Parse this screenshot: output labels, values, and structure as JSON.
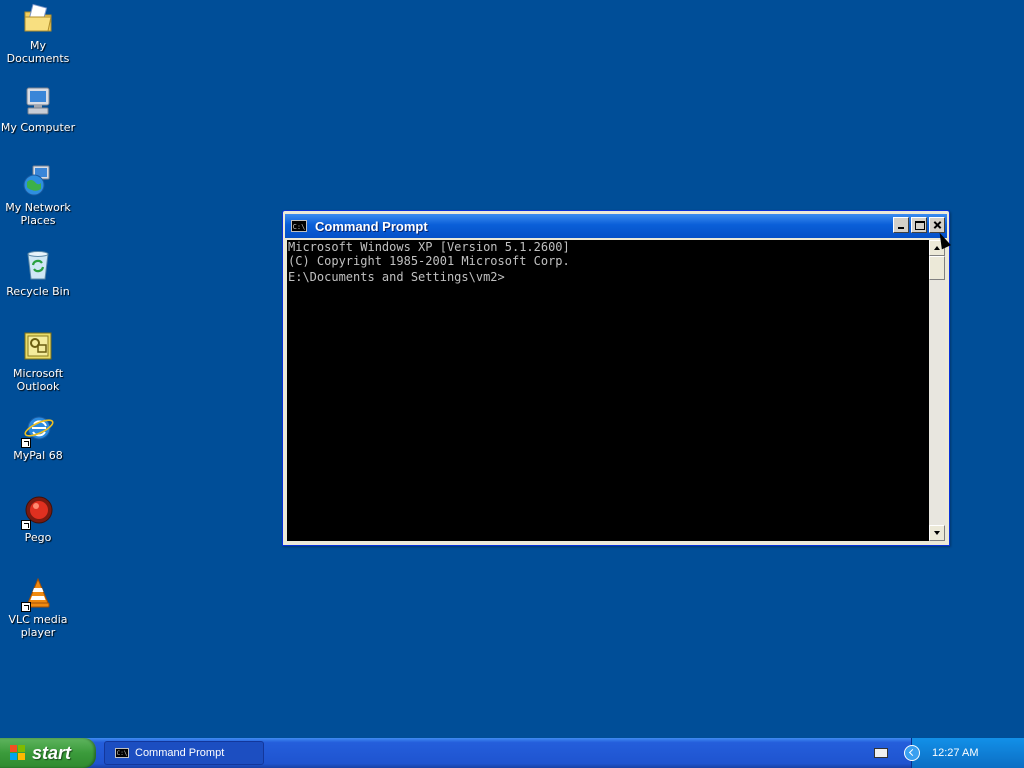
{
  "desktop": {
    "icons": [
      {
        "label": "My Documents",
        "icon": "folder-documents-icon"
      },
      {
        "label": "My Computer",
        "icon": "computer-icon"
      },
      {
        "label": "My Network\nPlaces",
        "icon": "network-globe-icon"
      },
      {
        "label": "Recycle Bin",
        "icon": "recycle-bin-icon"
      },
      {
        "label": "Microsoft\nOutlook",
        "icon": "outlook-icon"
      },
      {
        "label": "MyPal 68",
        "icon": "browser-icon"
      },
      {
        "label": "Pego",
        "icon": "pego-icon"
      },
      {
        "label": "VLC media\nplayer",
        "icon": "vlc-cone-icon"
      }
    ]
  },
  "window": {
    "title": "Command Prompt",
    "icon_text": "C:\\",
    "console_lines": [
      "Microsoft Windows XP [Version 5.1.2600]",
      "(C) Copyright 1985-2001 Microsoft Corp.",
      "",
      "E:\\Documents and Settings\\vm2>"
    ]
  },
  "taskbar": {
    "start_label": "start",
    "task_button_label": "Command Prompt",
    "task_icon_text": "C:\\",
    "clock": "12:27 AM"
  },
  "colors": {
    "desktop_bg": "#004e98",
    "titlebar": "#0a5fd8",
    "console_bg": "#000000",
    "console_fg": "#c0c0c0",
    "taskbar": "#245edb",
    "start_button": "#3b9b3b",
    "tray": "#0f7fd6"
  }
}
